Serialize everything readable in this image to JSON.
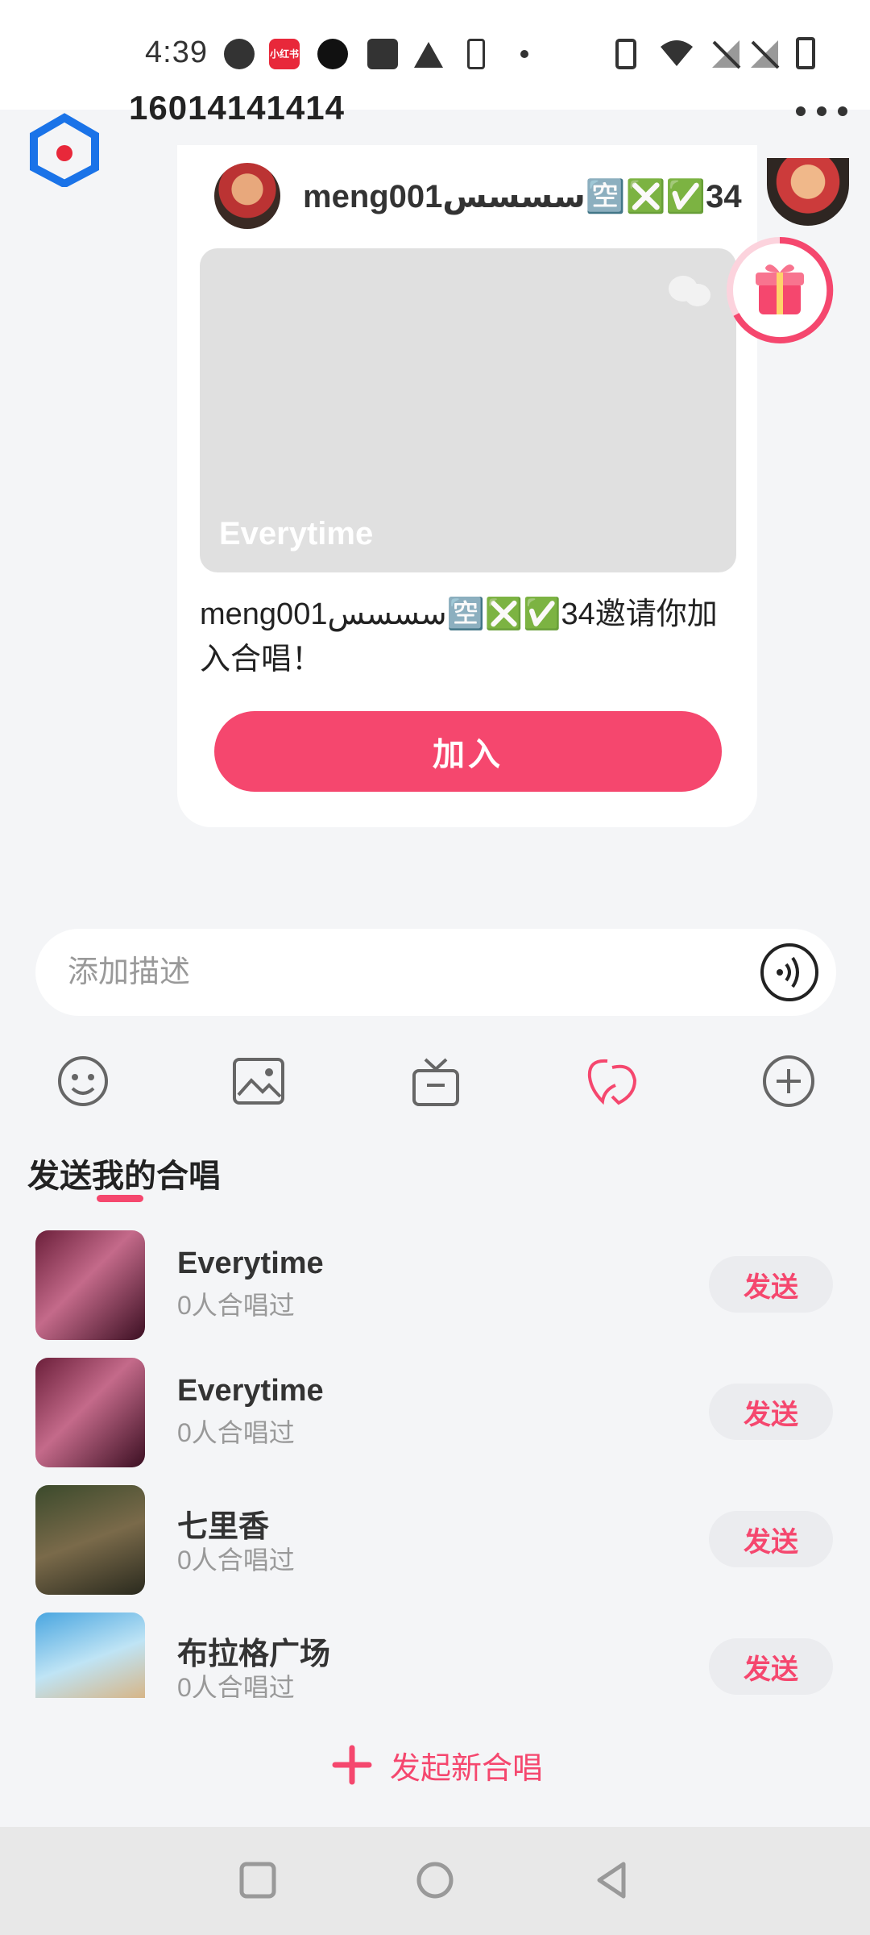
{
  "status_bar": {
    "time": "4:39",
    "app_badge_text": "小红书"
  },
  "header": {
    "title": "16014141414"
  },
  "invite": {
    "sender_name": "meng001سسسس🈳❎✅34",
    "song_title": "Everytime",
    "message": "meng001سسسس🈳❎✅34邀请你加入合唱！",
    "join_label": "加入"
  },
  "input": {
    "placeholder": "添加描述"
  },
  "tools": [
    "emoji-icon",
    "image-icon",
    "gift-icon",
    "chorus-icon",
    "plus-icon"
  ],
  "section": {
    "title": "发送我的合唱"
  },
  "songs": [
    {
      "title": "Everytime",
      "meta": "0人合唱过",
      "send_label": "发送"
    },
    {
      "title": "Everytime",
      "meta": "0人合唱过",
      "send_label": "发送"
    },
    {
      "title": "七里香",
      "meta": "0人合唱过",
      "send_label": "发送"
    },
    {
      "title": "布拉格广场",
      "meta": "0人合唱过",
      "send_label": "发送"
    }
  ],
  "new_chorus": {
    "label": "发起新合唱"
  },
  "colors": {
    "accent": "#f5476e",
    "background": "#f4f5f7"
  }
}
